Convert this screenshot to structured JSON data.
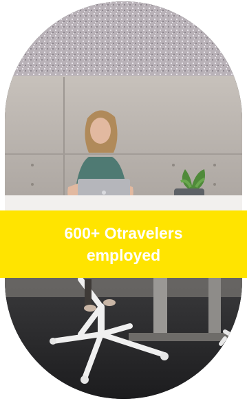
{
  "banner": {
    "text": "600+ Otravelers employed",
    "background": "#FFE400",
    "text_color": "#FFFFFF"
  },
  "photo": {
    "subject": "woman-working-on-laptop"
  }
}
